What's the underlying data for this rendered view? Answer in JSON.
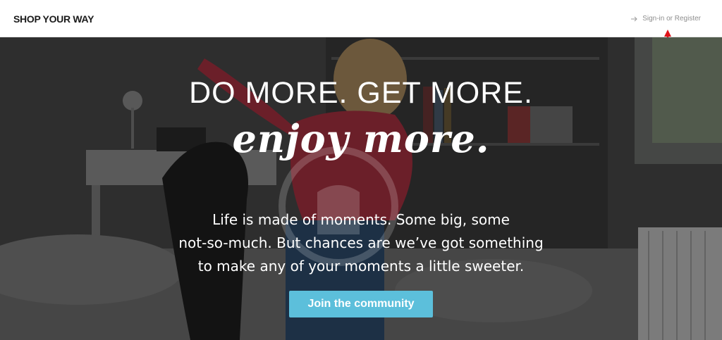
{
  "header": {
    "logo_text": "SHOP YOUR WAY",
    "signin_label": "Sign-in or Register",
    "signin_icon": "sign-in-arrow-icon"
  },
  "hero": {
    "headline": "DO MORE. GET MORE.",
    "script_line": "enjoy more.",
    "subtext_lines": [
      "Life is made of moments. Some big, some",
      "not-so-much. But chances are we’ve got something",
      "to make any of your moments a little sweeter."
    ],
    "cta_label": "Join the community",
    "overlay_mark": "watermark-hand-icon"
  },
  "colors": {
    "cta": "#5cbfdb",
    "annotation_arrow": "#e0141a",
    "logo": "#1b1b1b"
  }
}
